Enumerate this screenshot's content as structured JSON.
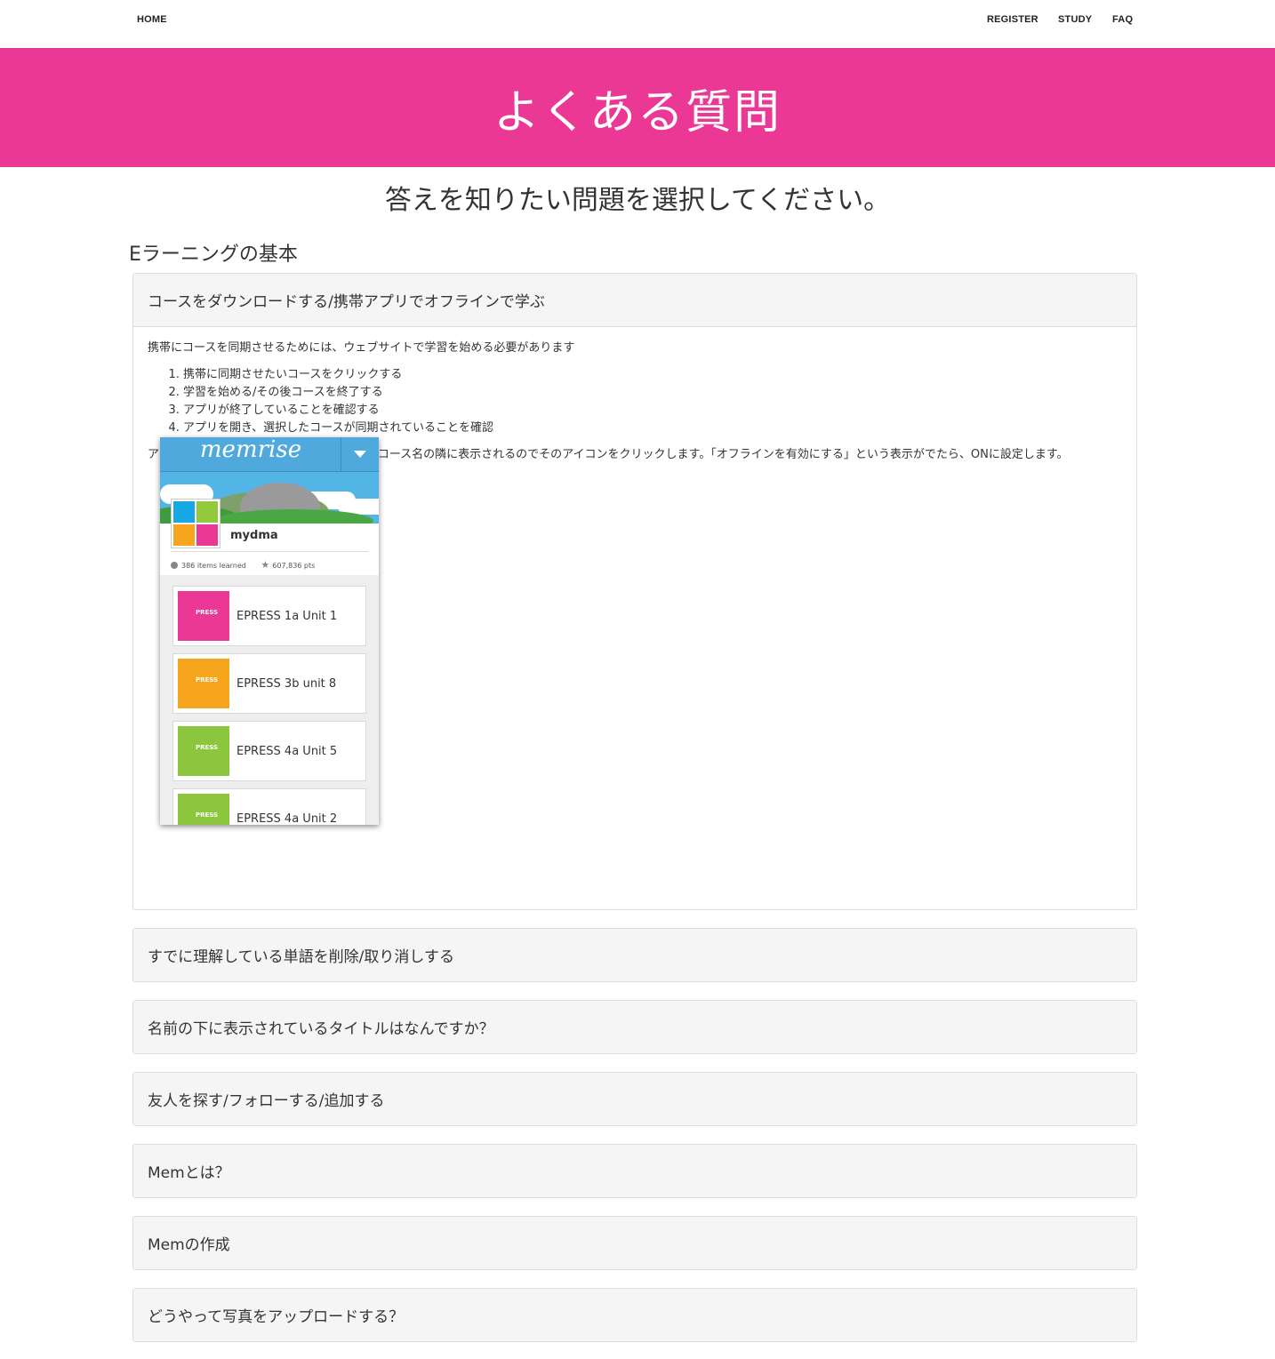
{
  "nav": {
    "home": "HOME",
    "register": "REGISTER",
    "study": "STUDY",
    "faq": "FAQ"
  },
  "banner": {
    "title": "よくある質問"
  },
  "subtitle": "答えを知りたい問題を選択してください。",
  "section": {
    "title": "Eラーニングの基本"
  },
  "faq_open": {
    "question": "コースをダウンロードする/携帯アプリでオフラインで学ぶ",
    "intro": "携帯にコースを同期させるためには、ウェブサイトで学習を始める必要があります",
    "steps": [
      "携帯に同期させたいコースをクリックする",
      "学習を始める/その後コースを終了する",
      "アプリが終了していることを確認する",
      "アプリを開き、選択したコースが同期されていることを確認"
    ],
    "note": "アプリをスタートさせると、歯車アイコンがコース名の隣に表示されるのでそのアイコンをクリックします。「オフラインを有効にする」という表示がでたら、ONに設定します。"
  },
  "phone": {
    "logo": "memrise",
    "username": "mydma",
    "items_learned": "386 items learned",
    "points": "607,836 pts",
    "thumb_label": "PRESS",
    "courses": [
      {
        "name": "EPRESS 1a Unit 1",
        "color": "#ec3895"
      },
      {
        "name": "EPRESS 3b unit 8",
        "color": "#f7a51c"
      },
      {
        "name": "EPRESS 4a Unit 5",
        "color": "#8cc63f"
      },
      {
        "name": "EPRESS 4a Unit 2",
        "color": "#8cc63f"
      }
    ]
  },
  "faq_closed": [
    "すでに理解している単語を削除/取り消しする",
    "名前の下に表示されているタイトルはなんですか？",
    "友人を探す/フォローする/追加する",
    "Memとは？",
    "Memの作成",
    "どうやって写真をアップロードする？"
  ],
  "colors": {
    "accent": "#ec3895",
    "panel_bg": "#f5f5f5"
  }
}
